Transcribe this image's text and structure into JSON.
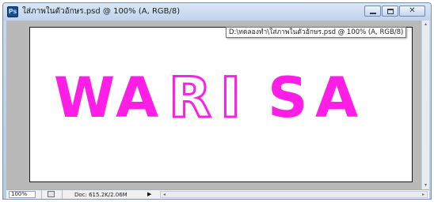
{
  "window": {
    "app_icon_text": "Ps",
    "title": "ใส่ภาพในตัวอักษร.psd @ 100% (A, RGB/8)",
    "controls": {
      "minimize": "minimize-icon",
      "maximize": "maximize-icon",
      "close": "close-icon",
      "close_glyph": "✕"
    }
  },
  "tooltip": {
    "text": "D:\\ทดลองทำ\\ใส่ภาพในตัวอักษร.psd @ 100% (A, RGB/8)"
  },
  "canvas": {
    "artwork_letters": [
      "W",
      "A",
      "R",
      "I",
      "S",
      "A"
    ],
    "fill_color": "#ff1ee6",
    "outline_letters_color": "#ff1ee6"
  },
  "statusbar": {
    "zoom": "100%",
    "doc_info": "Doc: 615.2K/2.06M",
    "menu_arrow": "▶",
    "scroll_left": "◂",
    "scroll_right": "▸"
  },
  "scrollbar": {
    "up": "▴",
    "down": "▾"
  }
}
